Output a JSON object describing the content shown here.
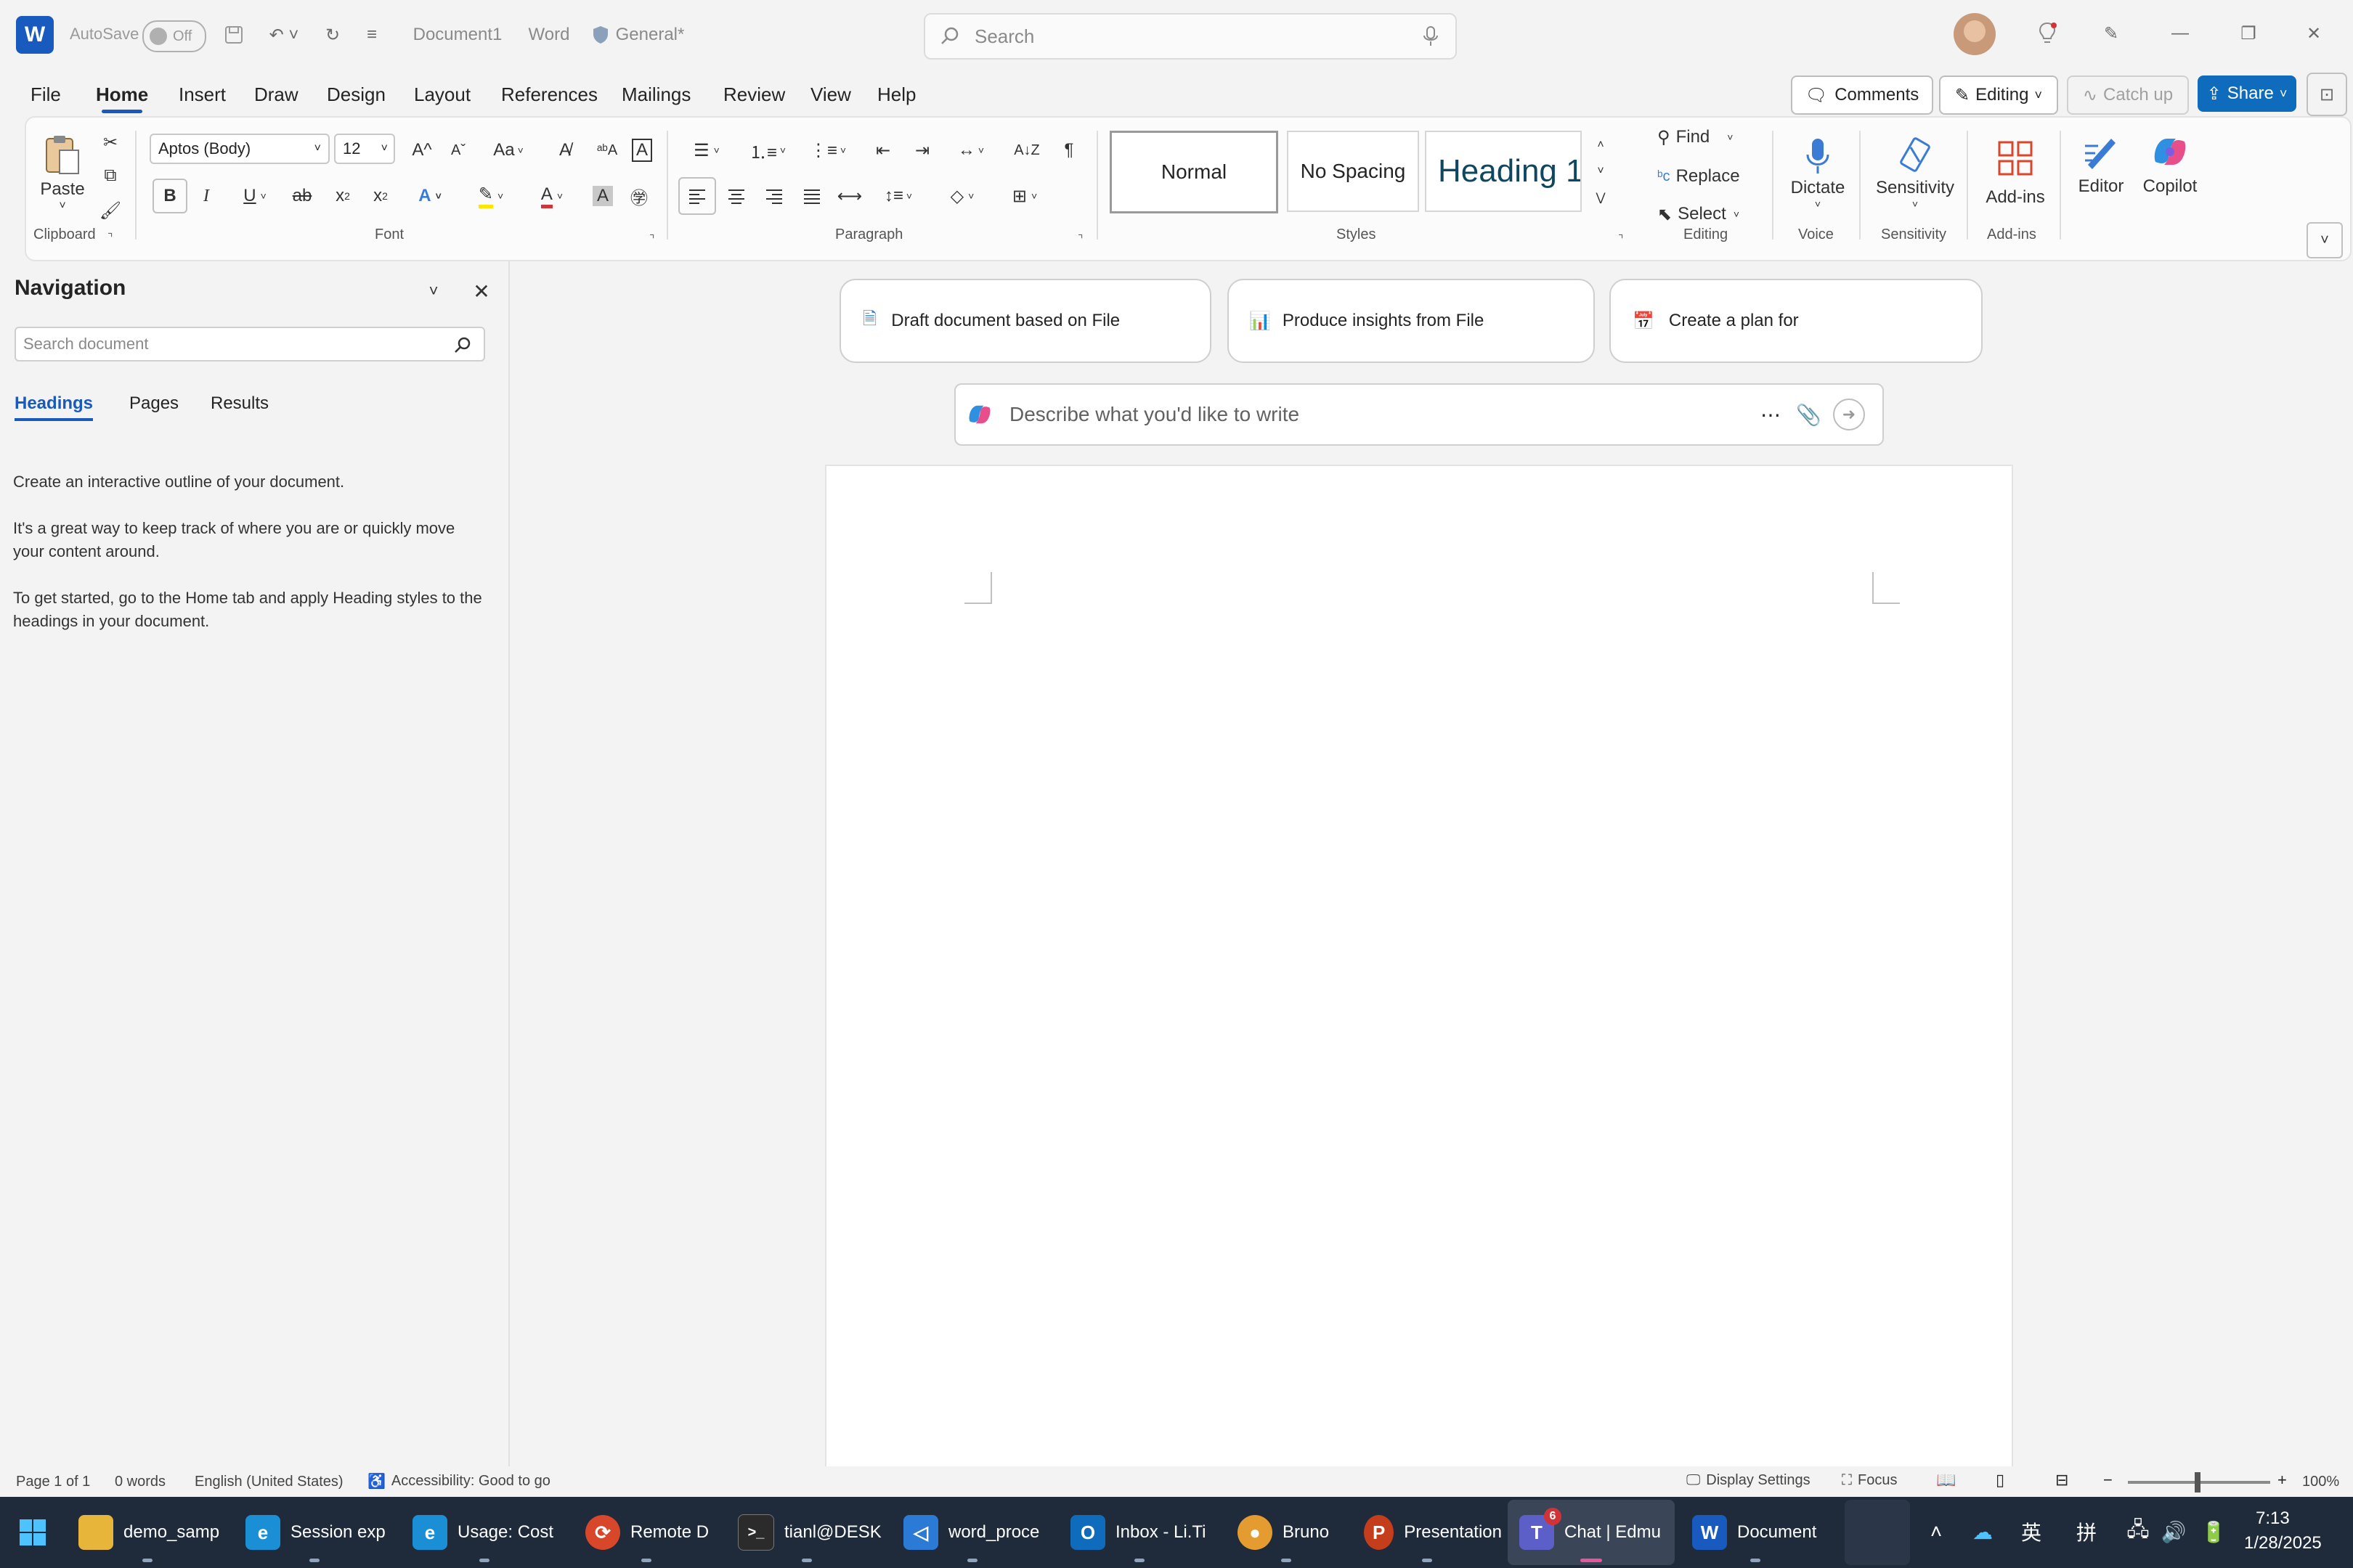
{
  "titlebar": {
    "autosave_label": "AutoSave",
    "autosave_state": "Off",
    "doc_title": "Document1",
    "app_name": "Word",
    "sensitivity_label": "General*",
    "search_placeholder": "Search"
  },
  "menu": {
    "tabs": [
      "File",
      "Home",
      "Insert",
      "Draw",
      "Design",
      "Layout",
      "References",
      "Mailings",
      "Review",
      "View",
      "Help"
    ],
    "active": "Home",
    "comments_label": "Comments",
    "editing_label": "Editing",
    "catchup_label": "Catch up",
    "share_label": "Share"
  },
  "ribbon": {
    "clipboard": {
      "paste_label": "Paste",
      "group_label": "Clipboard"
    },
    "font": {
      "font_name": "Aptos (Body)",
      "font_size": "12",
      "group_label": "Font",
      "change_case": "Aa"
    },
    "paragraph": {
      "group_label": "Paragraph"
    },
    "styles": {
      "normal": "Normal",
      "no_spacing": "No Spacing",
      "heading1": "Heading 1",
      "group_label": "Styles"
    },
    "editing": {
      "find": "Find",
      "replace": "Replace",
      "select": "Select",
      "group_label": "Editing"
    },
    "voice": {
      "dictate": "Dictate",
      "group_label": "Voice"
    },
    "sensitivity": {
      "label": "Sensitivity",
      "group_label": "Sensitivity"
    },
    "addins": {
      "label": "Add-ins",
      "group_label": "Add-ins"
    },
    "editor_label": "Editor",
    "copilot_label": "Copilot"
  },
  "navigation": {
    "title": "Navigation",
    "search_placeholder": "Search document",
    "tabs": [
      "Headings",
      "Pages",
      "Results"
    ],
    "active_tab": "Headings",
    "text1": "Create an interactive outline of your document.",
    "text2": "It's a great way to keep track of where you are or quickly move your content around.",
    "text3": "To get started, go to the Home tab and apply Heading styles to the headings in your document."
  },
  "copilot": {
    "cards": [
      "Draft document based on File",
      "Produce insights from File",
      "Create a plan for"
    ],
    "prompt_placeholder": "Describe what you'd like to write"
  },
  "status": {
    "page": "Page 1 of 1",
    "words": "0 words",
    "language": "English (United States)",
    "accessibility": "Accessibility: Good to go",
    "display_settings": "Display Settings",
    "focus": "Focus",
    "zoom": "100%"
  },
  "taskbar": {
    "apps": [
      {
        "label": "demo_samp",
        "color": "#e8b53b",
        "glyph": "▬"
      },
      {
        "label": "Session exp",
        "color": "#1b8fd6",
        "glyph": "e"
      },
      {
        "label": "Usage: Cost",
        "color": "#1b8fd6",
        "glyph": "e"
      },
      {
        "label": "Remote D",
        "color": "#d9472b",
        "glyph": "⟳"
      },
      {
        "label": "tianl@DESK",
        "color": "#2b2b2b",
        "glyph": ">_"
      },
      {
        "label": "word_proce",
        "color": "#2a7ad6",
        "glyph": "◁"
      },
      {
        "label": "Inbox - Li.Ti",
        "color": "#0f6cbd",
        "glyph": "O"
      },
      {
        "label": "Bruno",
        "color": "#e49b2f",
        "glyph": "●"
      },
      {
        "label": "Presentation",
        "color": "#c43e1c",
        "glyph": "P"
      },
      {
        "label": "Chat | Edmu",
        "color": "#5b5fc7",
        "glyph": "T"
      },
      {
        "label": "Document",
        "color": "#185abd",
        "glyph": "W"
      }
    ],
    "teams_badge": "6",
    "ime1": "英",
    "ime2": "拼",
    "time": "7:13",
    "date": "1/28/2025"
  }
}
